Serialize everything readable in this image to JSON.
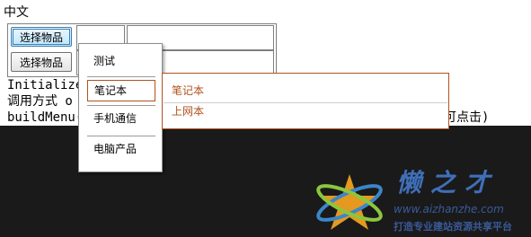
{
  "page": {
    "title": "中文"
  },
  "buttons": {
    "select_item_1": "选择物品",
    "select_item_2": "选择物品"
  },
  "code_lines": {
    "line1": "Initialize",
    "line2": "调用方式 o",
    "line3": "buildMenu(",
    "line3_tail": "可点击)"
  },
  "context_menu": {
    "items": [
      {
        "label": "测试"
      },
      {
        "label": "笔记本"
      },
      {
        "label": "手机通信"
      },
      {
        "label": "电脑产品"
      }
    ]
  },
  "submenu": {
    "items": [
      {
        "label": "笔记本"
      },
      {
        "label": "上网本"
      }
    ]
  },
  "watermark": {
    "title": "懒之才",
    "url": "www.aizhanzhe.com",
    "slogan": "打造专业建站资源共享平台"
  },
  "colors": {
    "accent": "#b0521e",
    "watermark": "#3f6fb8",
    "background": "#1a1a1a"
  }
}
